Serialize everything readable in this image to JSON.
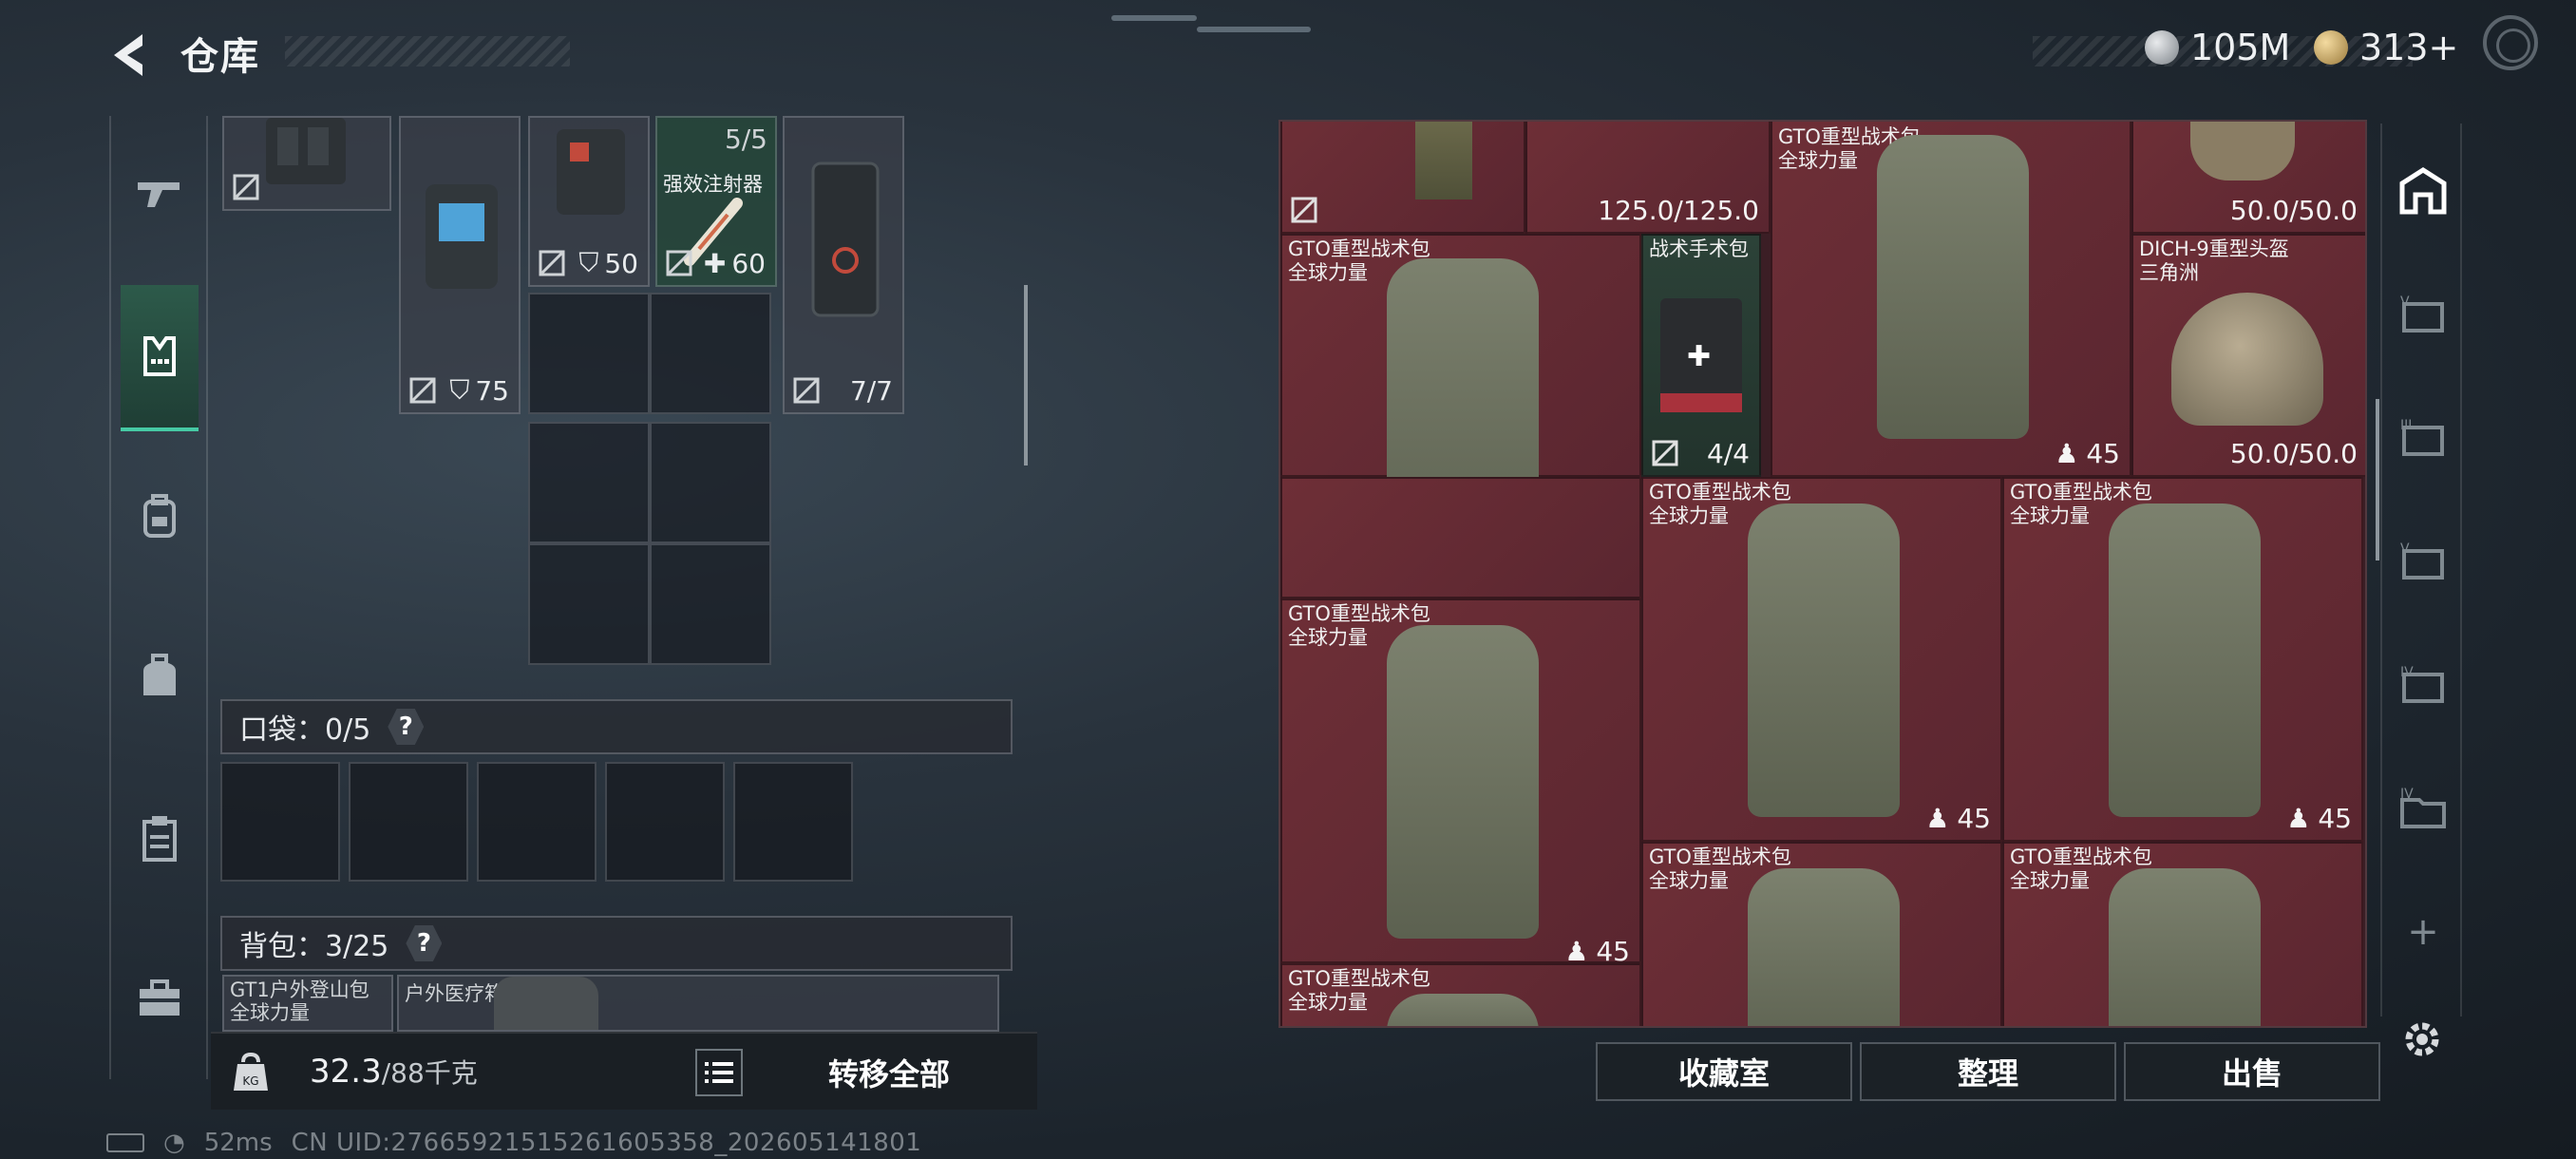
{
  "header": {
    "title": "仓库",
    "currency_1": "105M",
    "currency_2": "313+"
  },
  "left_rail": [
    "weapon-icon",
    "vest-icon",
    "backpack-icon",
    "bag-icon",
    "clipboard-icon",
    "toolbox-icon"
  ],
  "equipment": {
    "syringe_name": "强效注射器",
    "syringe_qty": "5/5",
    "syringe_heal": "60",
    "rig_armor_1": "50",
    "rig_armor_2": "75",
    "case_count": "7/7"
  },
  "pockets": {
    "label": "口袋：0/5",
    "help": "?"
  },
  "backpack": {
    "label": "背包：3/25",
    "help": "?",
    "item_1": "GT1户外登山包",
    "item_1_sub": "全球力量",
    "item_2": "户外医疗箱"
  },
  "bottom_bar": {
    "weight": "32.3",
    "weight_max": "/88千克",
    "transfer_all": "转移全部"
  },
  "storage": {
    "top_left_count": "125.0/125.0",
    "top_right_count": "50.0/50.0",
    "gto_name": "GTO重型战术包",
    "gto_sub": "全球力量",
    "gto_count": "45",
    "medkit_name": "战术手术包",
    "medkit_count": "4/4",
    "helmet_name": "DICH-9重型头盔",
    "helmet_sub": "三角洲",
    "helmet_count": "50.0/50.0"
  },
  "right_tabs": [
    "home-icon",
    "v-case-icon",
    "iii-case-icon",
    "v-case-2-icon",
    "iv-case-icon",
    "iv-folder-icon",
    "add-icon",
    "gear-icon"
  ],
  "buttons": {
    "collection": "收藏室",
    "organize": "整理",
    "sell": "出售"
  },
  "status": {
    "ping": "52ms",
    "uid": "CN UID:27665921515261605358_202605141801"
  }
}
